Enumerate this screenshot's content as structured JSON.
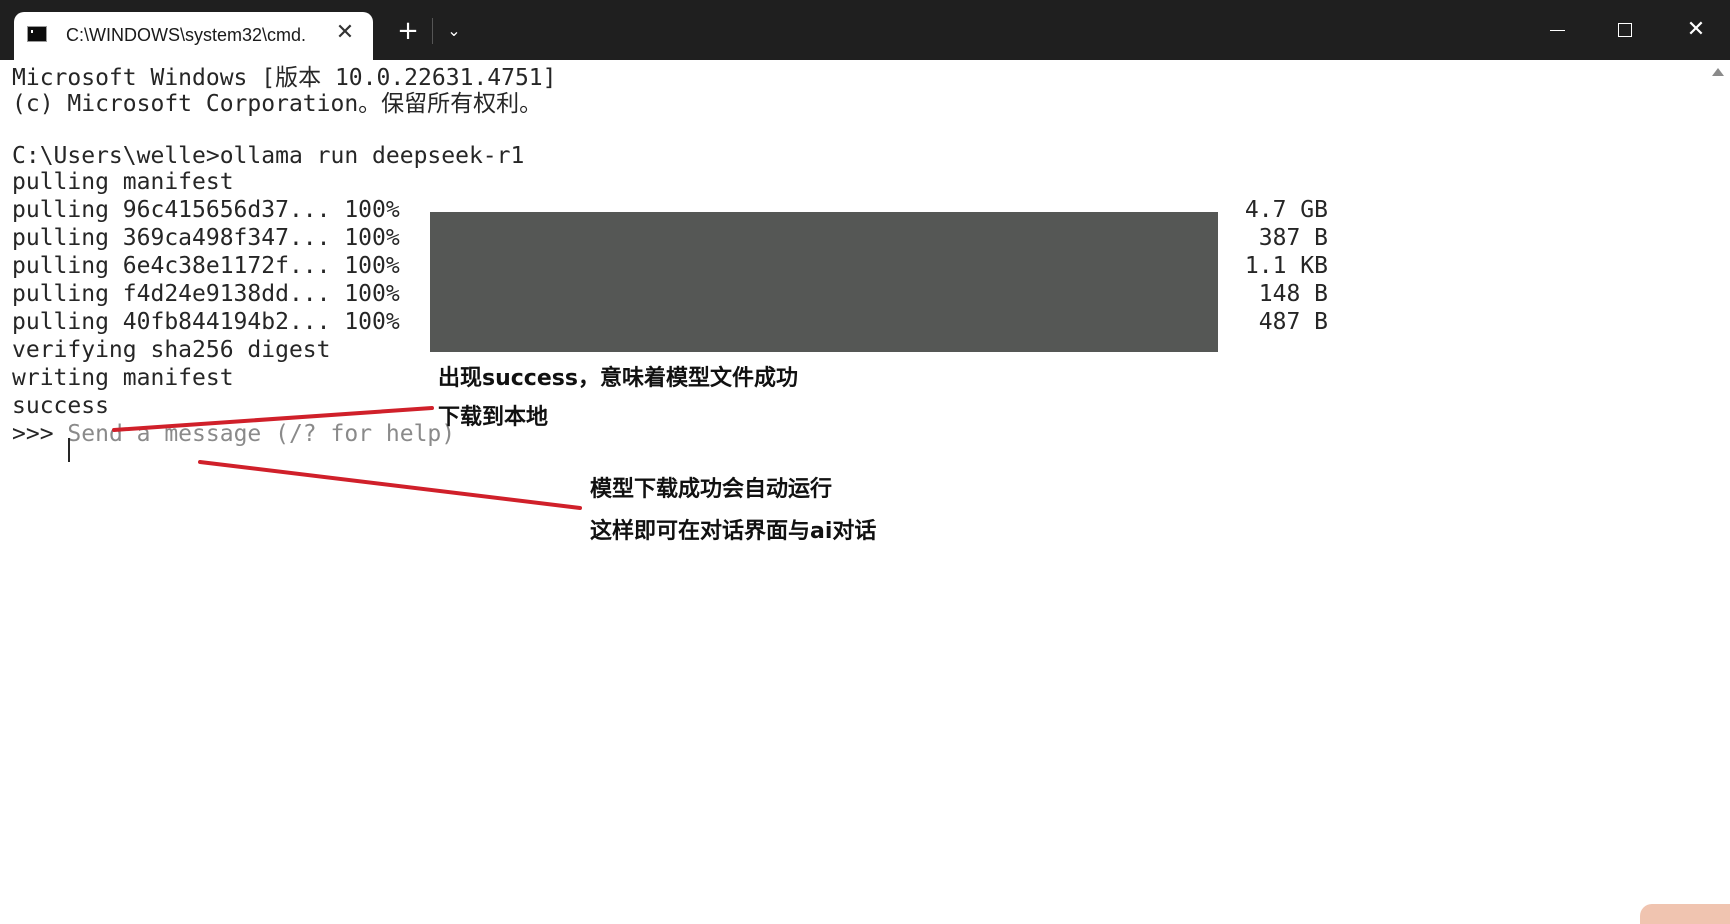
{
  "window": {
    "tab_title": "C:\\WINDOWS\\system32\\cmd.",
    "tab_close_glyph": "✕",
    "new_tab_glyph": "+",
    "dropdown_glyph": "⌄",
    "close_glyph": "✕",
    "tab_icon": "terminal-icon"
  },
  "terminal": {
    "lines": [
      "Microsoft Windows [版本 10.0.22631.4751]",
      "(c) Microsoft Corporation。保留所有权利。",
      "",
      "C:\\Users\\welle>ollama run deepseek-r1",
      "pulling manifest"
    ],
    "pulls": [
      {
        "label": "pulling 96c415656d37... 100%",
        "size": "4.7 GB"
      },
      {
        "label": "pulling 369ca498f347... 100%",
        "size": "387 B"
      },
      {
        "label": "pulling 6e4c38e1172f... 100%",
        "size": "1.1 KB"
      },
      {
        "label": "pulling f4d24e9138dd... 100%",
        "size": "148 B"
      },
      {
        "label": "pulling 40fb844194b2... 100%",
        "size": "487 B"
      }
    ],
    "progress_fraction": 1.0,
    "after_lines": [
      "verifying sha256 digest",
      "writing manifest",
      "success"
    ],
    "prompt": ">>>",
    "input_placeholder": "Send a message (/? for help)"
  },
  "annotations": {
    "note1_line1": "出现success，意味着模型文件成功",
    "note1_line2": "下载到本地",
    "note2_line1": "模型下载成功会自动运行",
    "note2_line2": "这样即可在对话界面与ai对话"
  },
  "colors": {
    "titlebar": "#1f1f1f",
    "progress_fill": "#555755",
    "annotation_line": "#d0202a",
    "text": "#262626"
  }
}
